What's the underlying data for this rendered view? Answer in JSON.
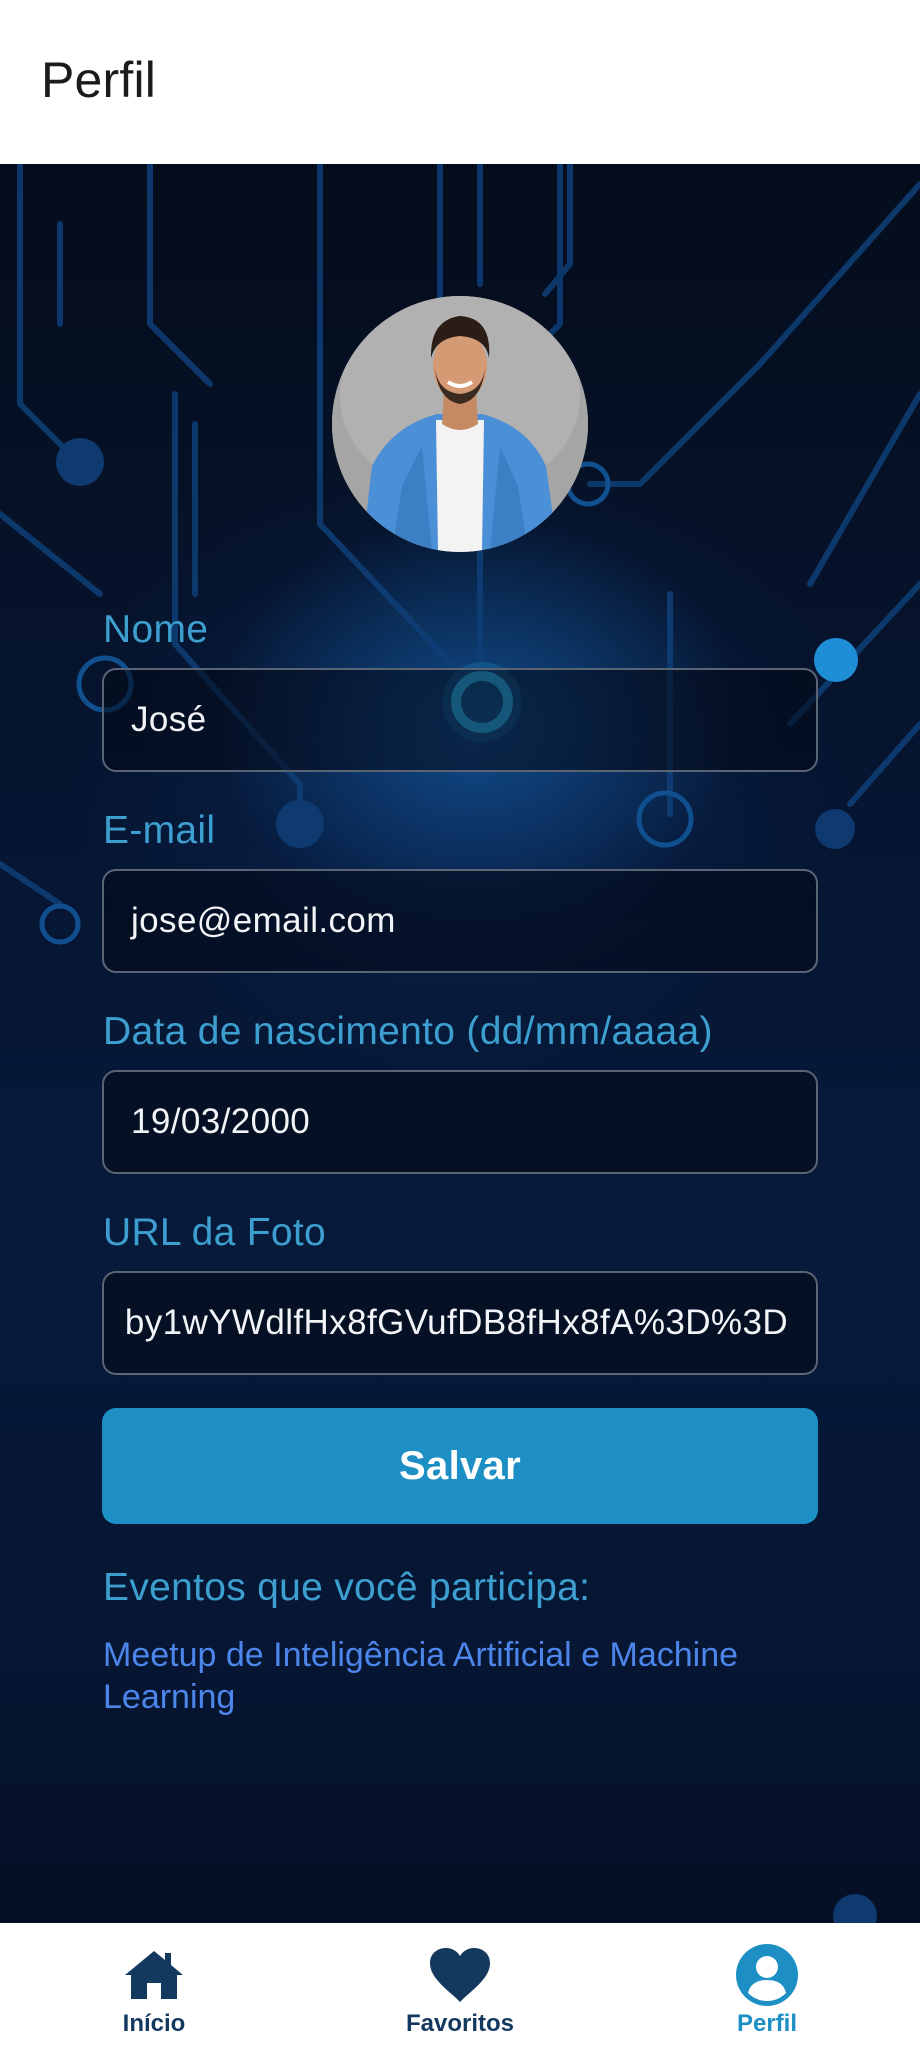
{
  "header": {
    "title": "Perfil"
  },
  "profile": {
    "fields": [
      {
        "label": "Nome",
        "value": "José"
      },
      {
        "label": "E-mail",
        "value": "jose@email.com"
      },
      {
        "label": "Data de nascimento (dd/mm/aaaa)",
        "value": "19/03/2000"
      },
      {
        "label": "URL da Foto",
        "value": "by1wYWdlfHx8fGVufDB8fHx8fA%3D%3D"
      }
    ],
    "save_label": "Salvar",
    "events_title": "Eventos que você participa:",
    "events": [
      "Meetup de Inteligência Artificial e Machine Learning"
    ]
  },
  "nav": {
    "items": [
      {
        "label": "Início",
        "icon": "home-icon"
      },
      {
        "label": "Favoritos",
        "icon": "heart-icon"
      },
      {
        "label": "Perfil",
        "icon": "user-icon",
        "active": true
      }
    ]
  },
  "colors": {
    "accent": "#1e8fc4",
    "label": "#3d9ed0",
    "link": "#4d86ea",
    "nav_dark": "#14395f",
    "background_dark": "#061633"
  }
}
